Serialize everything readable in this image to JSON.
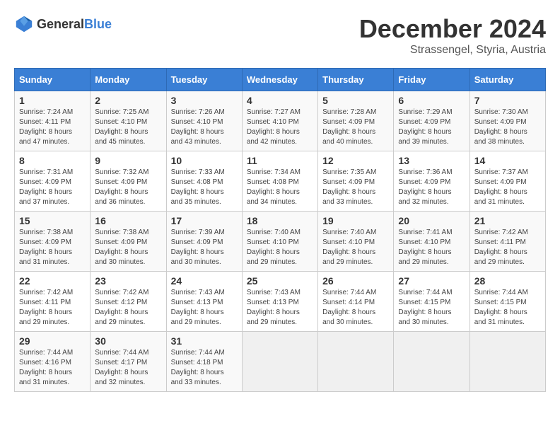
{
  "header": {
    "logo_general": "General",
    "logo_blue": "Blue",
    "month": "December 2024",
    "location": "Strassengel, Styria, Austria"
  },
  "calendar": {
    "days_of_week": [
      "Sunday",
      "Monday",
      "Tuesday",
      "Wednesday",
      "Thursday",
      "Friday",
      "Saturday"
    ],
    "weeks": [
      [
        {
          "day": "",
          "empty": true
        },
        {
          "day": "",
          "empty": true
        },
        {
          "day": "",
          "empty": true
        },
        {
          "day": "",
          "empty": true
        },
        {
          "day": "5",
          "sunrise": "Sunrise: 7:28 AM",
          "sunset": "Sunset: 4:09 PM",
          "daylight": "Daylight: 8 hours and 40 minutes."
        },
        {
          "day": "6",
          "sunrise": "Sunrise: 7:29 AM",
          "sunset": "Sunset: 4:09 PM",
          "daylight": "Daylight: 8 hours and 39 minutes."
        },
        {
          "day": "7",
          "sunrise": "Sunrise: 7:30 AM",
          "sunset": "Sunset: 4:09 PM",
          "daylight": "Daylight: 8 hours and 38 minutes."
        }
      ],
      [
        {
          "day": "1",
          "sunrise": "Sunrise: 7:24 AM",
          "sunset": "Sunset: 4:11 PM",
          "daylight": "Daylight: 8 hours and 47 minutes."
        },
        {
          "day": "2",
          "sunrise": "Sunrise: 7:25 AM",
          "sunset": "Sunset: 4:10 PM",
          "daylight": "Daylight: 8 hours and 45 minutes."
        },
        {
          "day": "3",
          "sunrise": "Sunrise: 7:26 AM",
          "sunset": "Sunset: 4:10 PM",
          "daylight": "Daylight: 8 hours and 43 minutes."
        },
        {
          "day": "4",
          "sunrise": "Sunrise: 7:27 AM",
          "sunset": "Sunset: 4:10 PM",
          "daylight": "Daylight: 8 hours and 42 minutes."
        },
        {
          "day": "5",
          "sunrise": "Sunrise: 7:28 AM",
          "sunset": "Sunset: 4:09 PM",
          "daylight": "Daylight: 8 hours and 40 minutes."
        },
        {
          "day": "6",
          "sunrise": "Sunrise: 7:29 AM",
          "sunset": "Sunset: 4:09 PM",
          "daylight": "Daylight: 8 hours and 39 minutes."
        },
        {
          "day": "7",
          "sunrise": "Sunrise: 7:30 AM",
          "sunset": "Sunset: 4:09 PM",
          "daylight": "Daylight: 8 hours and 38 minutes."
        }
      ],
      [
        {
          "day": "8",
          "sunrise": "Sunrise: 7:31 AM",
          "sunset": "Sunset: 4:09 PM",
          "daylight": "Daylight: 8 hours and 37 minutes."
        },
        {
          "day": "9",
          "sunrise": "Sunrise: 7:32 AM",
          "sunset": "Sunset: 4:09 PM",
          "daylight": "Daylight: 8 hours and 36 minutes."
        },
        {
          "day": "10",
          "sunrise": "Sunrise: 7:33 AM",
          "sunset": "Sunset: 4:08 PM",
          "daylight": "Daylight: 8 hours and 35 minutes."
        },
        {
          "day": "11",
          "sunrise": "Sunrise: 7:34 AM",
          "sunset": "Sunset: 4:08 PM",
          "daylight": "Daylight: 8 hours and 34 minutes."
        },
        {
          "day": "12",
          "sunrise": "Sunrise: 7:35 AM",
          "sunset": "Sunset: 4:09 PM",
          "daylight": "Daylight: 8 hours and 33 minutes."
        },
        {
          "day": "13",
          "sunrise": "Sunrise: 7:36 AM",
          "sunset": "Sunset: 4:09 PM",
          "daylight": "Daylight: 8 hours and 32 minutes."
        },
        {
          "day": "14",
          "sunrise": "Sunrise: 7:37 AM",
          "sunset": "Sunset: 4:09 PM",
          "daylight": "Daylight: 8 hours and 31 minutes."
        }
      ],
      [
        {
          "day": "15",
          "sunrise": "Sunrise: 7:38 AM",
          "sunset": "Sunset: 4:09 PM",
          "daylight": "Daylight: 8 hours and 31 minutes."
        },
        {
          "day": "16",
          "sunrise": "Sunrise: 7:38 AM",
          "sunset": "Sunset: 4:09 PM",
          "daylight": "Daylight: 8 hours and 30 minutes."
        },
        {
          "day": "17",
          "sunrise": "Sunrise: 7:39 AM",
          "sunset": "Sunset: 4:09 PM",
          "daylight": "Daylight: 8 hours and 30 minutes."
        },
        {
          "day": "18",
          "sunrise": "Sunrise: 7:40 AM",
          "sunset": "Sunset: 4:10 PM",
          "daylight": "Daylight: 8 hours and 29 minutes."
        },
        {
          "day": "19",
          "sunrise": "Sunrise: 7:40 AM",
          "sunset": "Sunset: 4:10 PM",
          "daylight": "Daylight: 8 hours and 29 minutes."
        },
        {
          "day": "20",
          "sunrise": "Sunrise: 7:41 AM",
          "sunset": "Sunset: 4:10 PM",
          "daylight": "Daylight: 8 hours and 29 minutes."
        },
        {
          "day": "21",
          "sunrise": "Sunrise: 7:42 AM",
          "sunset": "Sunset: 4:11 PM",
          "daylight": "Daylight: 8 hours and 29 minutes."
        }
      ],
      [
        {
          "day": "22",
          "sunrise": "Sunrise: 7:42 AM",
          "sunset": "Sunset: 4:11 PM",
          "daylight": "Daylight: 8 hours and 29 minutes."
        },
        {
          "day": "23",
          "sunrise": "Sunrise: 7:42 AM",
          "sunset": "Sunset: 4:12 PM",
          "daylight": "Daylight: 8 hours and 29 minutes."
        },
        {
          "day": "24",
          "sunrise": "Sunrise: 7:43 AM",
          "sunset": "Sunset: 4:13 PM",
          "daylight": "Daylight: 8 hours and 29 minutes."
        },
        {
          "day": "25",
          "sunrise": "Sunrise: 7:43 AM",
          "sunset": "Sunset: 4:13 PM",
          "daylight": "Daylight: 8 hours and 29 minutes."
        },
        {
          "day": "26",
          "sunrise": "Sunrise: 7:44 AM",
          "sunset": "Sunset: 4:14 PM",
          "daylight": "Daylight: 8 hours and 30 minutes."
        },
        {
          "day": "27",
          "sunrise": "Sunrise: 7:44 AM",
          "sunset": "Sunset: 4:15 PM",
          "daylight": "Daylight: 8 hours and 30 minutes."
        },
        {
          "day": "28",
          "sunrise": "Sunrise: 7:44 AM",
          "sunset": "Sunset: 4:15 PM",
          "daylight": "Daylight: 8 hours and 31 minutes."
        }
      ],
      [
        {
          "day": "29",
          "sunrise": "Sunrise: 7:44 AM",
          "sunset": "Sunset: 4:16 PM",
          "daylight": "Daylight: 8 hours and 31 minutes."
        },
        {
          "day": "30",
          "sunrise": "Sunrise: 7:44 AM",
          "sunset": "Sunset: 4:17 PM",
          "daylight": "Daylight: 8 hours and 32 minutes."
        },
        {
          "day": "31",
          "sunrise": "Sunrise: 7:44 AM",
          "sunset": "Sunset: 4:18 PM",
          "daylight": "Daylight: 8 hours and 33 minutes."
        },
        {
          "day": "",
          "empty": true
        },
        {
          "day": "",
          "empty": true
        },
        {
          "day": "",
          "empty": true
        },
        {
          "day": "",
          "empty": true
        }
      ]
    ]
  }
}
